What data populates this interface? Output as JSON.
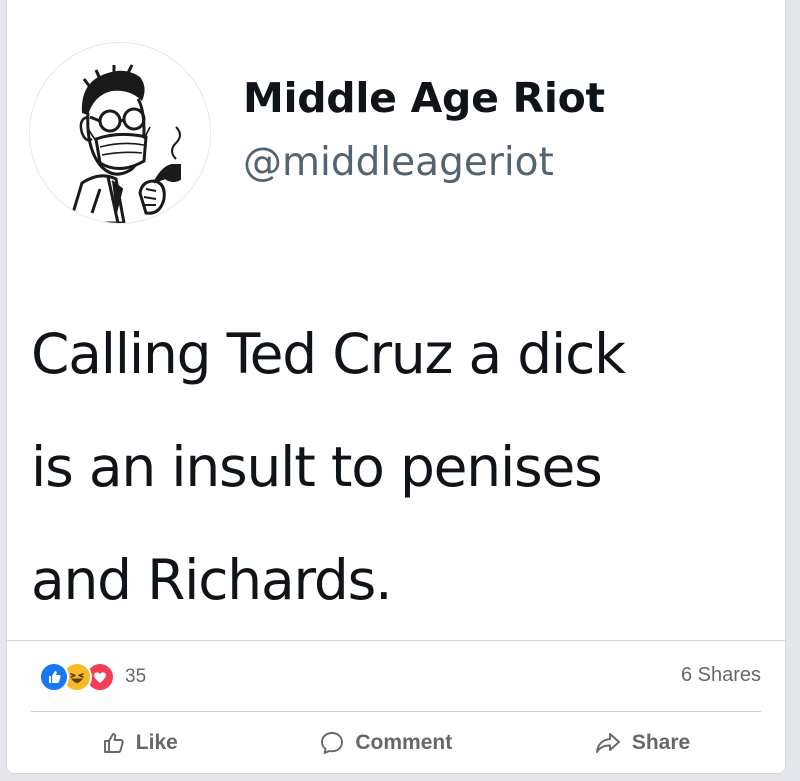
{
  "tweet": {
    "author_name": "Middle Age Riot",
    "author_handle": "@middleageriot",
    "text_lines": [
      "Calling Ted Cruz a dick",
      "is an insult to penises",
      "and Richards."
    ]
  },
  "post": {
    "reaction_count": "35",
    "shares_label": "6 Shares",
    "reactions": [
      "like-icon",
      "haha-icon",
      "love-icon"
    ],
    "actions": {
      "like": "Like",
      "comment": "Comment",
      "share": "Share"
    }
  },
  "colors": {
    "like_blue": "#1877f2",
    "haha_yellow": "#f7b928",
    "love_red": "#f33e58",
    "meta_gray": "#65676b",
    "handle_gray": "#536471"
  }
}
